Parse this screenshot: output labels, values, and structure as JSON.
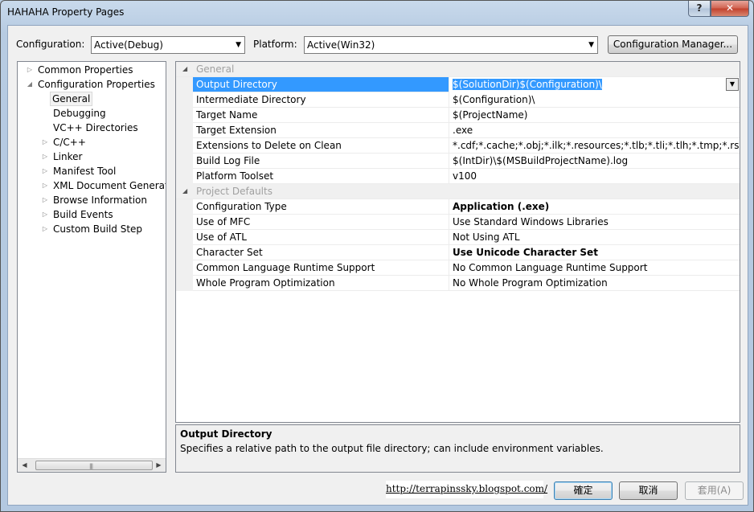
{
  "window": {
    "title": "HAHAHA Property Pages",
    "help": "?",
    "close": "✕"
  },
  "toolbar": {
    "configuration_label": "Configuration:",
    "configuration_value": "Active(Debug)",
    "platform_label": "Platform:",
    "platform_value": "Active(Win32)",
    "config_manager": "Configuration Manager..."
  },
  "tree": {
    "items": [
      {
        "label": "Common Properties",
        "expander": "▷"
      },
      {
        "label": "Configuration Properties",
        "expander": "◢"
      },
      {
        "label": "General",
        "expander": ""
      },
      {
        "label": "Debugging",
        "expander": ""
      },
      {
        "label": "VC++ Directories",
        "expander": ""
      },
      {
        "label": "C/C++",
        "expander": "▷"
      },
      {
        "label": "Linker",
        "expander": "▷"
      },
      {
        "label": "Manifest Tool",
        "expander": "▷"
      },
      {
        "label": "XML Document Generator",
        "expander": "▷"
      },
      {
        "label": "Browse Information",
        "expander": "▷"
      },
      {
        "label": "Build Events",
        "expander": "▷"
      },
      {
        "label": "Custom Build Step",
        "expander": "▷"
      }
    ],
    "scroll_left": "◀",
    "scroll_right": "▶",
    "grip": "|||"
  },
  "grid": {
    "cat_general": "General",
    "cat_defaults": "Project Defaults",
    "cat_expander": "◢",
    "general_rows": [
      {
        "name": "Output Directory",
        "value": "$(SolutionDir)$(Configuration)\\"
      },
      {
        "name": "Intermediate Directory",
        "value": "$(Configuration)\\"
      },
      {
        "name": "Target Name",
        "value": "$(ProjectName)"
      },
      {
        "name": "Target Extension",
        "value": ".exe"
      },
      {
        "name": "Extensions to Delete on Clean",
        "value": "*.cdf;*.cache;*.obj;*.ilk;*.resources;*.tlb;*.tli;*.tlh;*.tmp;*.rsp;*.pgc;*.pgd;*.meta;*.tlog;*.manifest;*.res;*.pch;*.exp;*.idb;*.rep;*.xdc;*.pdb;*_manifest.rc;*.bsc;*.sbr;*.xml;*.metagen;*.bi"
      },
      {
        "name": "Build Log File",
        "value": "$(IntDir)\\$(MSBuildProjectName).log"
      },
      {
        "name": "Platform Toolset",
        "value": "v100"
      }
    ],
    "default_rows": [
      {
        "name": "Configuration Type",
        "value": "Application (.exe)"
      },
      {
        "name": "Use of MFC",
        "value": "Use Standard Windows Libraries"
      },
      {
        "name": "Use of ATL",
        "value": "Not Using ATL"
      },
      {
        "name": "Character Set",
        "value": "Use Unicode Character Set"
      },
      {
        "name": "Common Language Runtime Support",
        "value": "No Common Language Runtime Support"
      },
      {
        "name": "Whole Program Optimization",
        "value": "No Whole Program Optimization"
      }
    ],
    "dropdown_arrow": "▼"
  },
  "description": {
    "title": "Output Directory",
    "text": "Specifies a relative path to the output file directory; can include environment variables."
  },
  "watermark": "http://terrapinssky.blogspot.com/",
  "buttons": {
    "ok": "確定",
    "cancel": "取消",
    "apply": "套用(A)"
  },
  "combo_arrow": "▼"
}
